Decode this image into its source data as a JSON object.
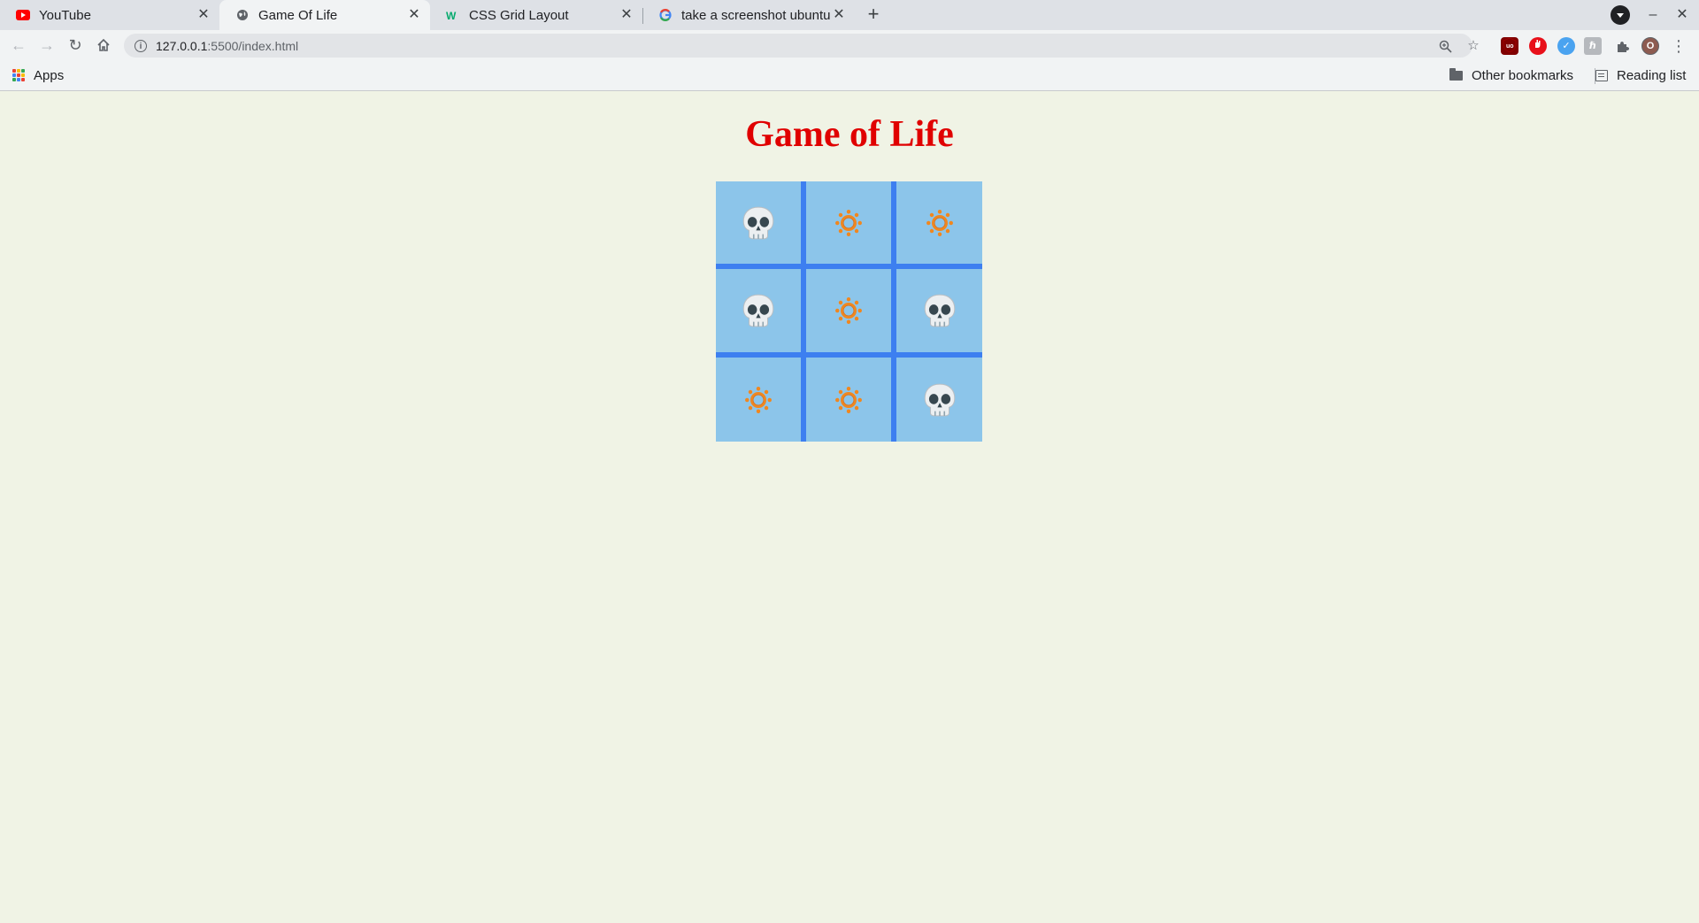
{
  "browser": {
    "tabs": [
      {
        "title": "YouTube",
        "icon": "youtube-icon",
        "active": false
      },
      {
        "title": "Game Of Life",
        "icon": "globe-icon",
        "active": true
      },
      {
        "title": "CSS Grid Layout",
        "icon": "w3schools-icon",
        "active": false
      },
      {
        "title": "take a screenshot ubuntu",
        "icon": "google-icon",
        "active": false
      }
    ],
    "url_host": "127.0.0.1",
    "url_path": ":5500/index.html",
    "profile_initial": "O",
    "bookmarks": {
      "apps_label": "Apps",
      "other_label": "Other bookmarks",
      "reading_list_label": "Reading list"
    }
  },
  "page": {
    "title": "Game of Life",
    "title_color": "#e00000",
    "cell_color": "#8cc5ea",
    "grid_line_color": "#3d7ff0",
    "cells": [
      [
        "dead",
        "alive",
        "alive"
      ],
      [
        "dead",
        "alive",
        "dead"
      ],
      [
        "alive",
        "alive",
        "dead"
      ]
    ],
    "icon_legend": {
      "dead": "skull-icon",
      "alive": "sun-icon"
    }
  }
}
